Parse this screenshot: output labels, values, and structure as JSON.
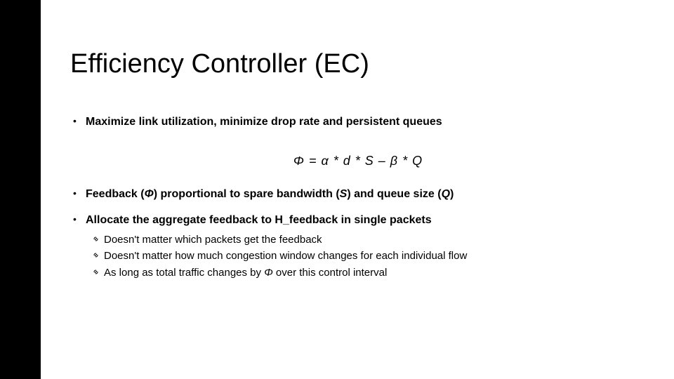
{
  "title": "Efficiency Controller (EC)",
  "bullet1": "Maximize link utilization, minimize drop rate and persistent queues",
  "formula": {
    "lhs": "Φ",
    "eq": " = ",
    "alpha": "α",
    "m1": " * d * S – ",
    "beta": "β",
    "m2": " * Q"
  },
  "bullet2": {
    "p1": "Feedback (",
    "phi": "Φ",
    "p2": ") ",
    "prop": "proportional",
    "p3": " to spare bandwidth  (",
    "s": "S",
    "p4": ") and queue size (",
    "q": "Q",
    "p5": ")"
  },
  "bullet3": "Allocate the aggregate feedback to H_feedback in single packets",
  "sub": {
    "a": "Doesn't matter which packets get the feedback",
    "b": "Doesn't matter how much congestion window changes for each individual flow",
    "c_p1": "As long as total traffic changes by ",
    "c_phi": "Φ",
    "c_p2": " over this control interval"
  }
}
